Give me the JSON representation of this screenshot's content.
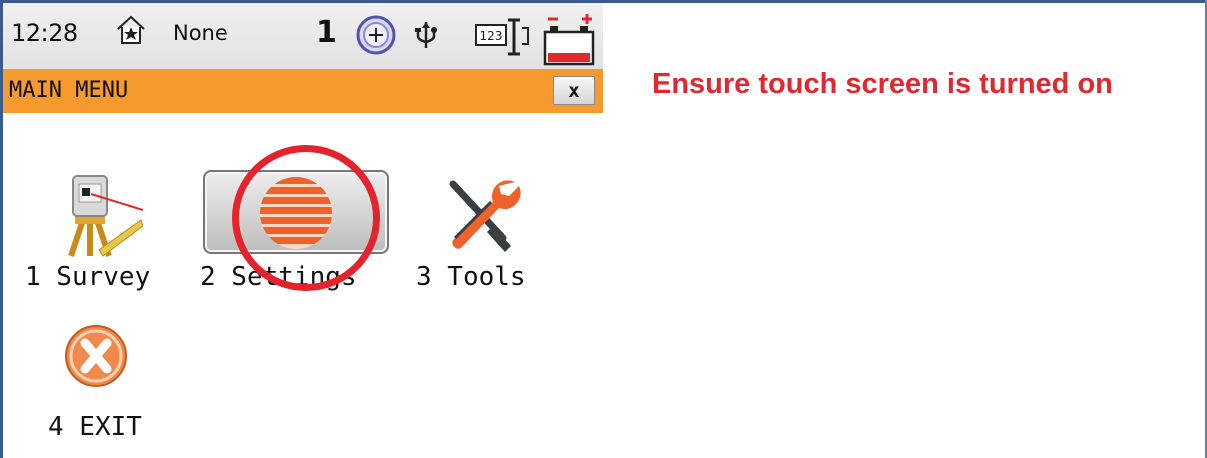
{
  "status_bar": {
    "time": "12:28",
    "mode_text": "None",
    "count": "1",
    "icons": [
      "star-house-icon",
      "target-icon",
      "usb-icon",
      "keyboard-123-icon",
      "battery-icon"
    ]
  },
  "title_bar": {
    "title": "MAIN MENU",
    "close_label": "x"
  },
  "menu": {
    "items": [
      {
        "label": "1 Survey",
        "icon": "survey-instrument-icon"
      },
      {
        "label": "2 Settings",
        "icon": "globe-icon"
      },
      {
        "label": "3 Tools",
        "icon": "tools-icon"
      },
      {
        "label": "4 EXIT",
        "icon": "exit-icon"
      }
    ]
  },
  "annotation": {
    "text": "Ensure touch screen is turned on",
    "color": "#e1272f"
  },
  "colors": {
    "title_bar": "#f79a2e",
    "frame": "#3b5b8f",
    "exit_orange": "#f0894a"
  }
}
